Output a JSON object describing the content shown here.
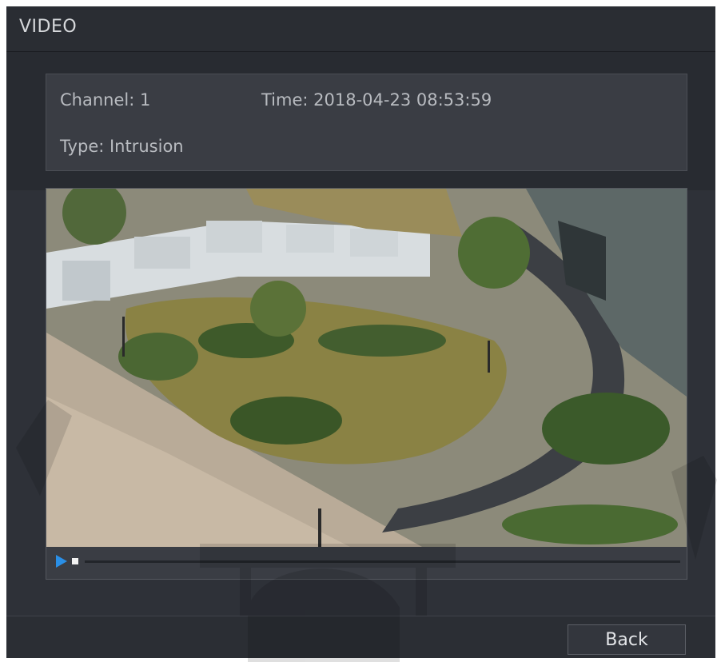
{
  "window": {
    "title": "VIDEO"
  },
  "info": {
    "channel": "Channel: 1",
    "time": "Time: 2018-04-23 08:53:59",
    "type": "Type: Intrusion"
  },
  "player": {
    "play_icon": "play-icon",
    "stop_icon": "stop-icon",
    "progress": 0.0,
    "accent_color": "#2a8fe6"
  },
  "footer": {
    "back_label": "Back"
  }
}
